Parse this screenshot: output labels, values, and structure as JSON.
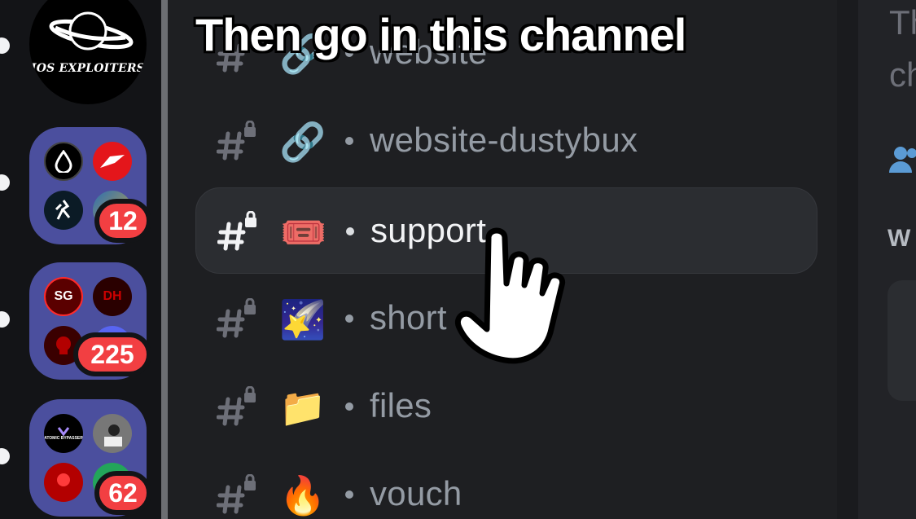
{
  "caption": "Then go in this channel",
  "servers": [
    {
      "name": "IOS EXPLOITERS",
      "type": "server"
    },
    {
      "type": "folder",
      "badge": "12"
    },
    {
      "type": "folder",
      "badge": "225",
      "mini_labels": [
        "SG",
        "DH"
      ]
    },
    {
      "type": "folder",
      "badge": "62",
      "mini_labels": [
        "ATOMIC BYPASSER"
      ]
    }
  ],
  "channels": [
    {
      "name": "website",
      "emoji": "🔗",
      "selected": false
    },
    {
      "name": "website-dustybux",
      "emoji": "🔗",
      "selected": false
    },
    {
      "name": "support",
      "emoji": "🎟️",
      "selected": true
    },
    {
      "name": "short",
      "emoji": "🌠",
      "selected": false
    },
    {
      "name": "files",
      "emoji": "📁",
      "selected": false
    },
    {
      "name": "vouch",
      "emoji": "🔥",
      "selected": false
    }
  ],
  "right_panel": {
    "line1": "Th",
    "line2": "ch",
    "heading": "W"
  },
  "colors": {
    "background": "#1e1f22",
    "selected_row": "#2b2d31",
    "badge": "#f23f42",
    "folder": "#4b4f9e"
  },
  "icons": {
    "channel": "locked-hash-icon",
    "members": "people-icon",
    "pointer": "hand-pointer-icon"
  }
}
